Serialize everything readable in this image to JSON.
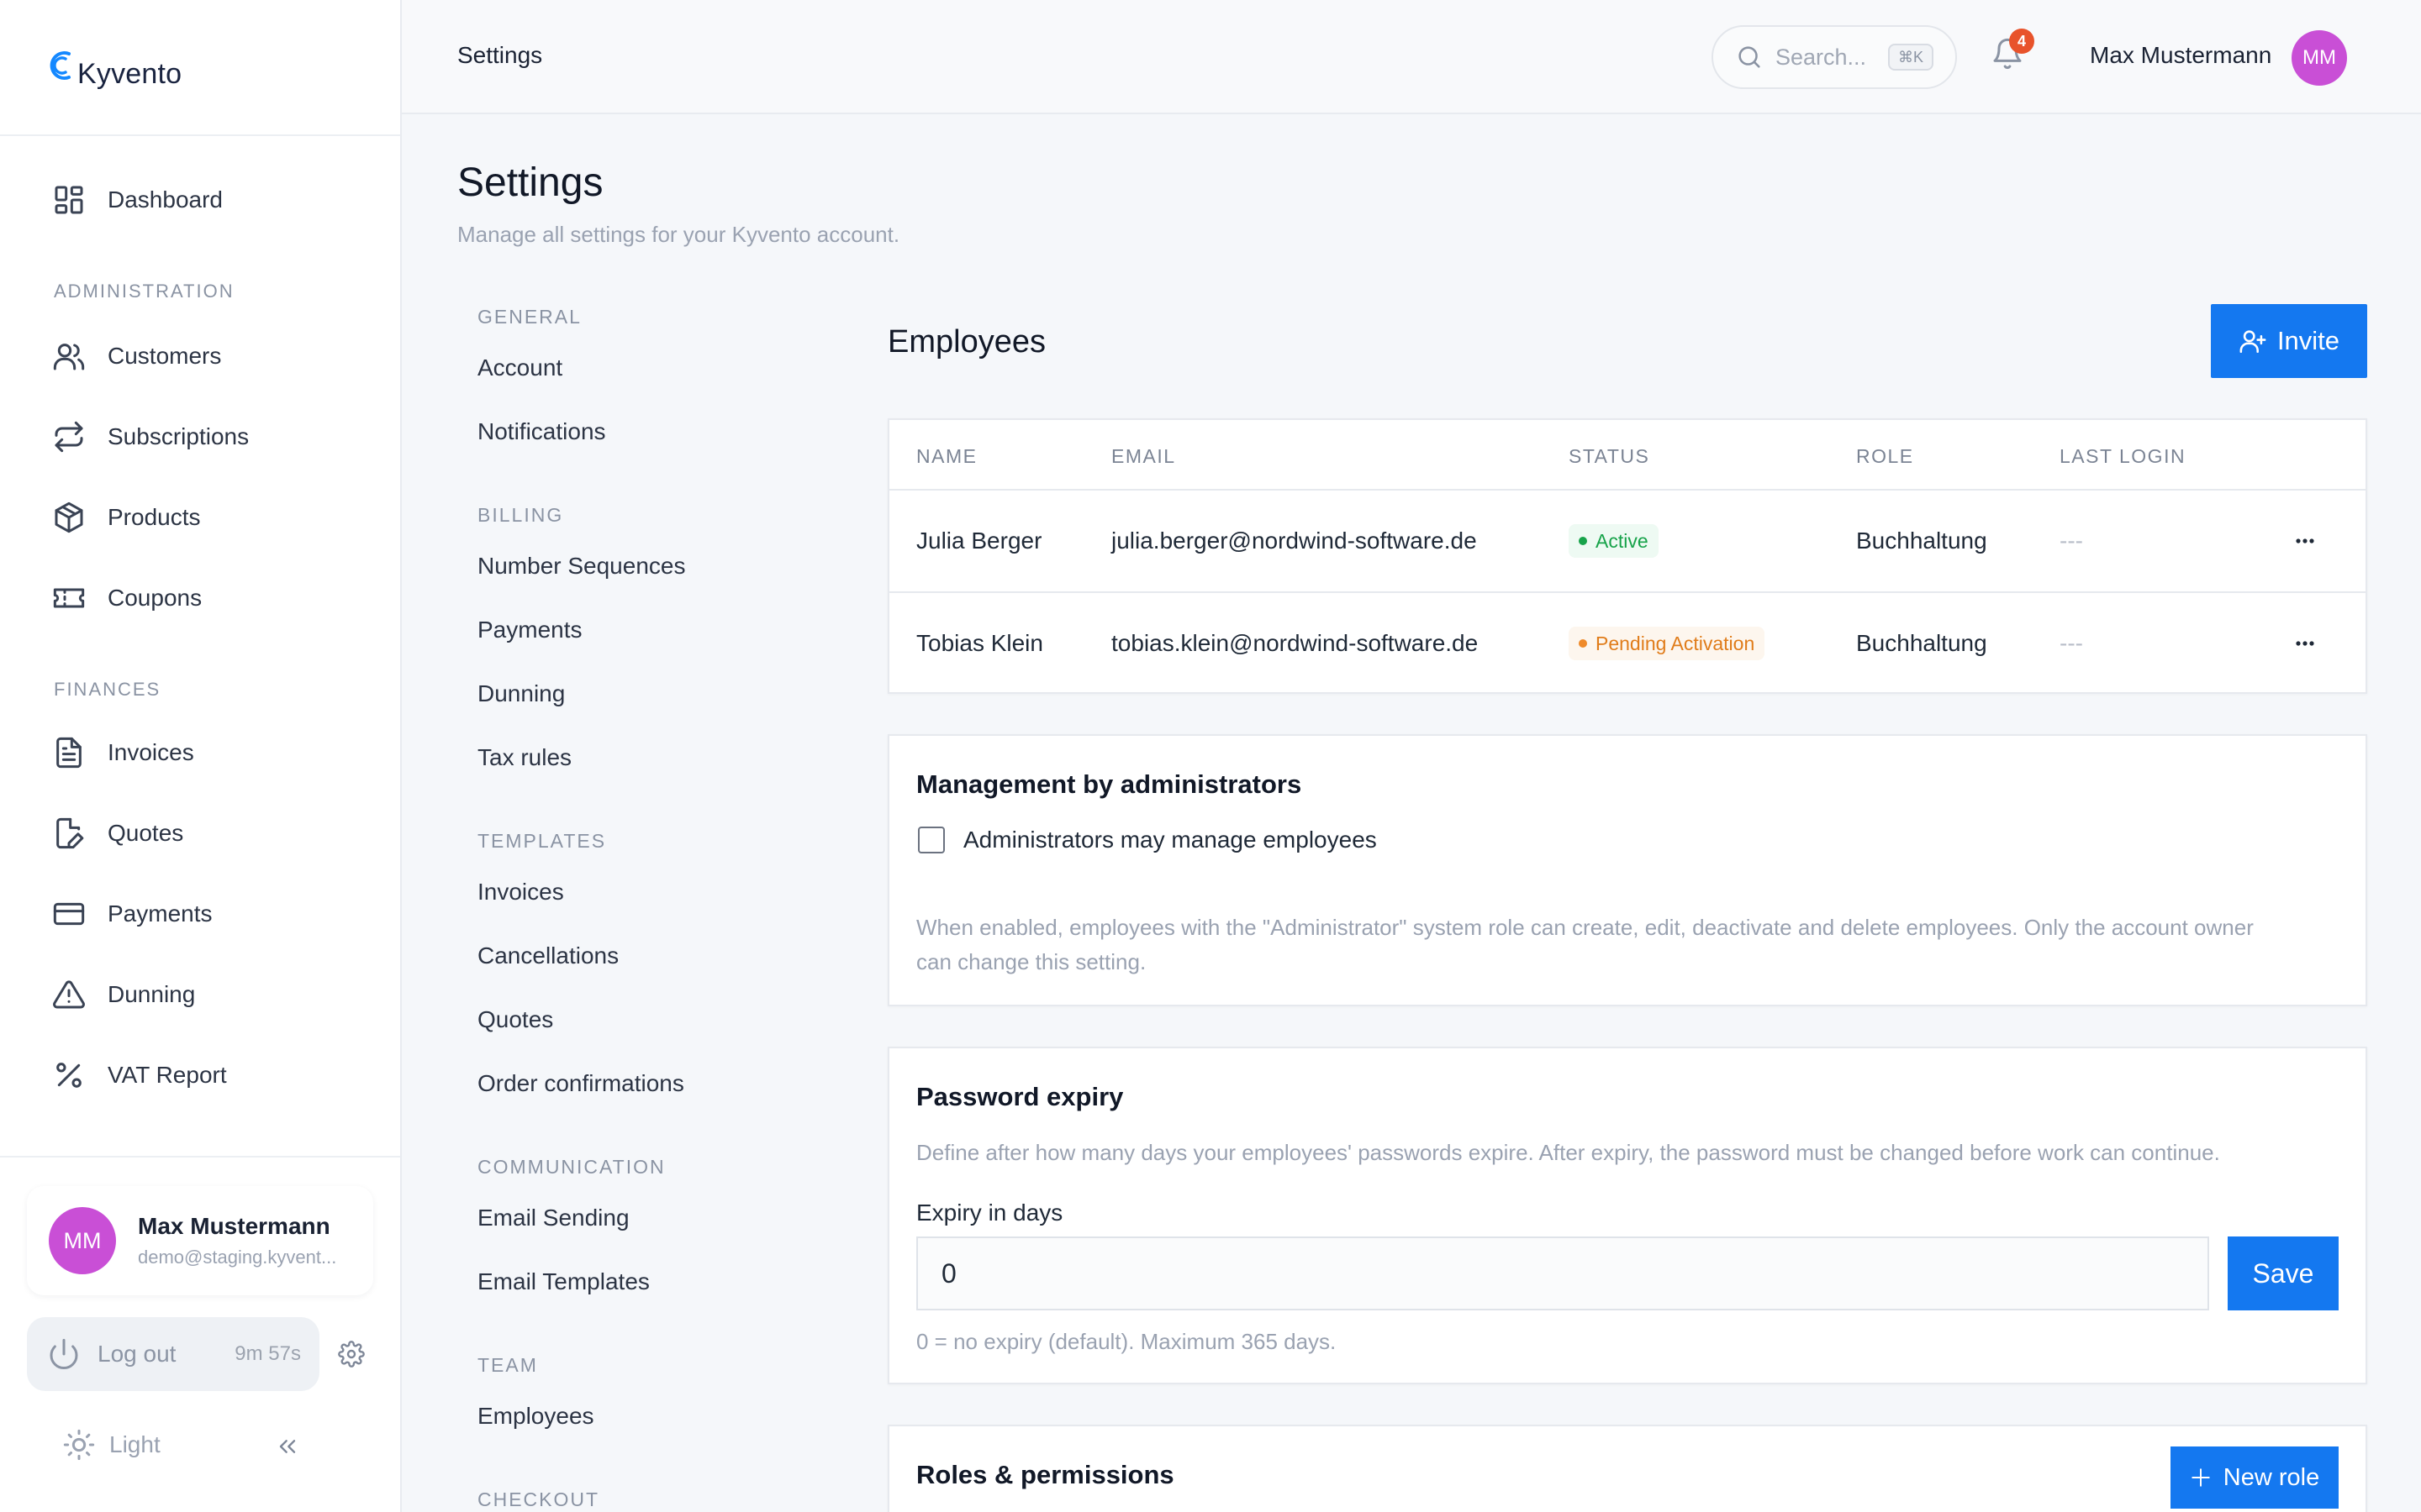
{
  "brand": {
    "name": "Kyvento",
    "accent": "#1478f0",
    "avatar_color": "#c94fd6"
  },
  "sidebar": {
    "dashboard": {
      "label": "Dashboard",
      "icon": "dashboard-icon"
    },
    "sections": [
      {
        "title": "ADMINISTRATION",
        "items": [
          {
            "label": "Customers",
            "icon": "users-icon"
          },
          {
            "label": "Subscriptions",
            "icon": "repeat-icon"
          },
          {
            "label": "Products",
            "icon": "box-icon"
          },
          {
            "label": "Coupons",
            "icon": "ticket-icon"
          }
        ]
      },
      {
        "title": "FINANCES",
        "items": [
          {
            "label": "Invoices",
            "icon": "file-text-icon"
          },
          {
            "label": "Quotes",
            "icon": "file-edit-icon"
          },
          {
            "label": "Payments",
            "icon": "credit-card-icon"
          },
          {
            "label": "Dunning",
            "icon": "alert-triangle-icon"
          },
          {
            "label": "VAT Report",
            "icon": "percent-icon"
          }
        ]
      }
    ],
    "profile": {
      "initials": "MM",
      "name": "Max Mustermann",
      "email": "demo@staging.kyvent..."
    },
    "logout": {
      "label": "Log out",
      "timer": "9m 57s"
    },
    "theme": {
      "label": "Light"
    }
  },
  "topbar": {
    "title": "Settings",
    "search": {
      "placeholder": "Search...",
      "shortcut": "⌘K"
    },
    "notifications": {
      "count": "4"
    },
    "user": {
      "name": "Max Mustermann",
      "initials": "MM"
    }
  },
  "page": {
    "title": "Settings",
    "subtitle": "Manage all settings for your Kyvento account."
  },
  "settings_nav": [
    {
      "title": "GENERAL",
      "items": [
        "Account",
        "Notifications"
      ]
    },
    {
      "title": "BILLING",
      "items": [
        "Number Sequences",
        "Payments",
        "Dunning",
        "Tax rules"
      ]
    },
    {
      "title": "TEMPLATES",
      "items": [
        "Invoices",
        "Cancellations",
        "Quotes",
        "Order confirmations"
      ]
    },
    {
      "title": "COMMUNICATION",
      "items": [
        "Email Sending",
        "Email Templates"
      ]
    },
    {
      "title": "TEAM",
      "items": [
        "Employees"
      ]
    },
    {
      "title": "CHECKOUT",
      "items": []
    }
  ],
  "employees": {
    "title": "Employees",
    "invite_label": "Invite",
    "columns": [
      "NAME",
      "EMAIL",
      "STATUS",
      "ROLE",
      "LAST LOGIN"
    ],
    "rows": [
      {
        "name": "Julia Berger",
        "email": "julia.berger@nordwind-software.de",
        "status": "Active",
        "role": "Buchhaltung",
        "last_login": "---"
      },
      {
        "name": "Tobias Klein",
        "email": "tobias.klein@nordwind-software.de",
        "status": "Pending Activation",
        "role": "Buchhaltung",
        "last_login": "---"
      }
    ]
  },
  "management": {
    "title": "Management by administrators",
    "checkbox_label": "Administrators may manage employees",
    "checked": false,
    "description_line1": "When enabled, employees with the \"Administrator\" system role can create, edit, deactivate and delete employees. Only the account owner",
    "description_line2": "can change this setting."
  },
  "password_expiry": {
    "title": "Password expiry",
    "description": "Define after how many days your employees' passwords expire. After expiry, the password must be changed before work can continue.",
    "field_label": "Expiry in days",
    "value": "0",
    "save_label": "Save",
    "hint": "0 = no expiry (default). Maximum 365 days."
  },
  "roles": {
    "title": "Roles & permissions",
    "new_role_label": "New role"
  }
}
